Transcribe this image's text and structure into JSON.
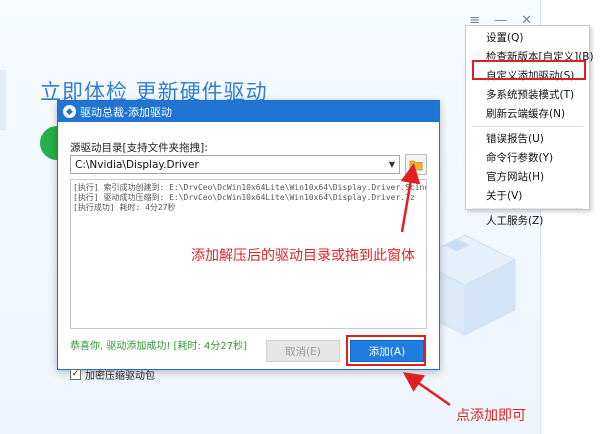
{
  "background": {
    "headline": "立即体检 更新硬件驱动",
    "controls": [
      "≡",
      "—",
      "✕"
    ]
  },
  "menu": {
    "items": [
      {
        "label": "设置(Q)"
      },
      {
        "label": "检查新版本[自定义](B)"
      },
      {
        "label": "自定义添加驱动(S)"
      },
      {
        "label": "多系统预装模式(T)"
      },
      {
        "label": "刷新云端缓存(N)"
      },
      {
        "label": "错误报告(U)"
      },
      {
        "label": "命令行参数(Y)"
      },
      {
        "label": "官方网站(H)"
      },
      {
        "label": "关于(V)"
      },
      {
        "label": "人工服务(Z)"
      }
    ],
    "highlighted_index": 2
  },
  "dialog": {
    "title": "驱动总裁-添加驱动",
    "source_label": "源驱动目录[支持文件夹拖拽]:",
    "path_value": "C:\\Nvidia\\Display.Driver",
    "log_lines": [
      "[执行] 索引成功创建到: E:\\DrvCeo\\DcWin10x64Lite\\Win10x64\\Display.Driver.Scind",
      "[执行] 驱动成功压缩到: E:\\DrvCeo\\DcWin10x64Lite\\Win10x64\\Display.Driver.7z",
      "[执行成功] 耗时: 4分27秒"
    ],
    "success_message": "恭喜你, 驱动添加成功! [耗时: 4分27秒]",
    "compress_checkbox_label": "加密压缩驱动包",
    "compress_checked": true,
    "cancel_label": "取消(E)",
    "add_label": "添加(A)"
  },
  "annotations": {
    "folder_hint": "添加解压后的驱动目录或拖到此窗体",
    "add_hint": "点添加即可"
  },
  "colors": {
    "accent": "#1f74d4",
    "annotation": "#e02020",
    "success": "#2e9a2e"
  }
}
